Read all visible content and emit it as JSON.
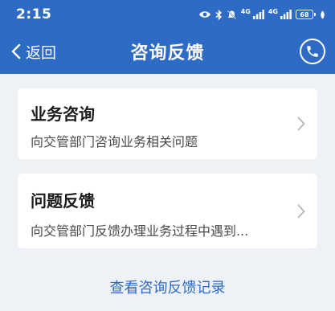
{
  "status_bar": {
    "time": "2:15",
    "net_label_1": "4G",
    "net_label_2": "4G",
    "battery": "68",
    "icons": [
      "eye-icon",
      "bluetooth-icon",
      "mute-icon",
      "signal-icon",
      "signal-icon",
      "battery-icon",
      "leaf-icon"
    ]
  },
  "header": {
    "back_label": "返回",
    "title": "咨询反馈",
    "phone_icon": "phone-icon",
    "accent_color": "#2e6bc4"
  },
  "cards": [
    {
      "title": "业务咨询",
      "description": "向交管部门咨询业务相关问题"
    },
    {
      "title": "问题反馈",
      "description": "向交管部门反馈办理业务过程中遇到..."
    }
  ],
  "records_link": "查看咨询反馈记录"
}
